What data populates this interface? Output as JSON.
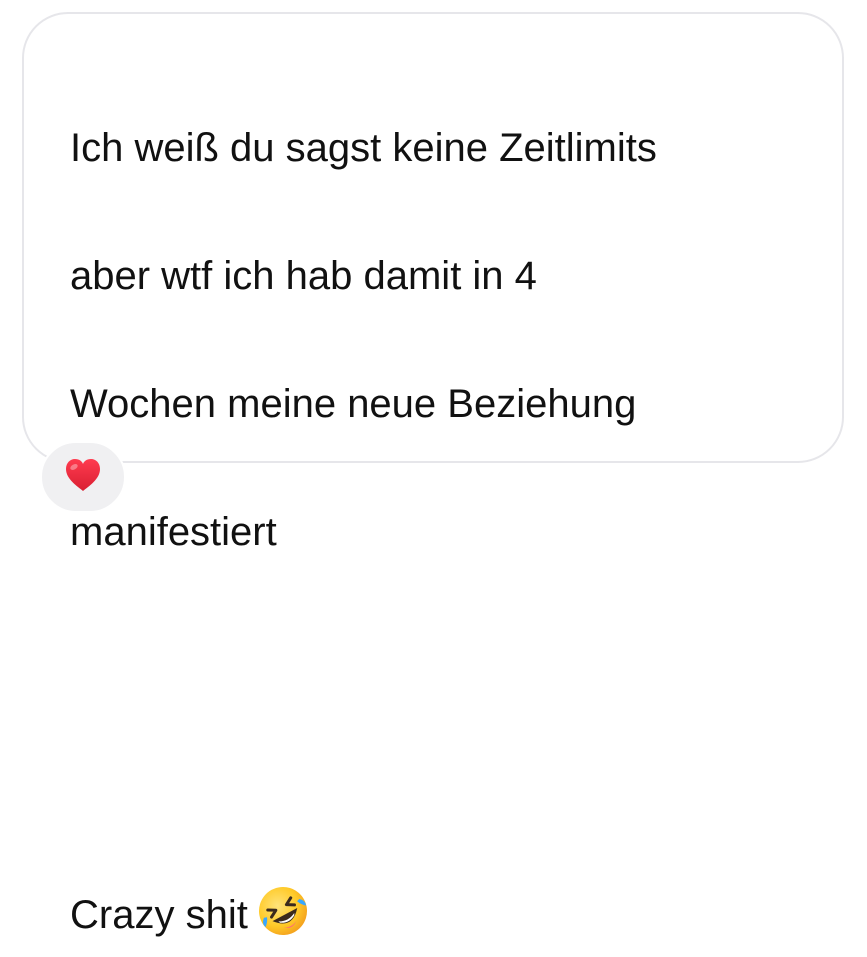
{
  "message": {
    "lines": [
      "Ich weiß du sagst keine Zeitlimits",
      "aber wtf ich hab damit in 4",
      "Wochen meine neue Beziehung",
      "manifestiert",
      "",
      "Crazy shit"
    ],
    "emoji": "rolling-on-floor-laughing-emoji"
  },
  "reaction": {
    "icon": "red-heart-icon",
    "color": "#e0243a"
  },
  "colors": {
    "bubble_border": "#e6e6ea",
    "reaction_background": "#f0f0f2",
    "text": "#111111"
  }
}
